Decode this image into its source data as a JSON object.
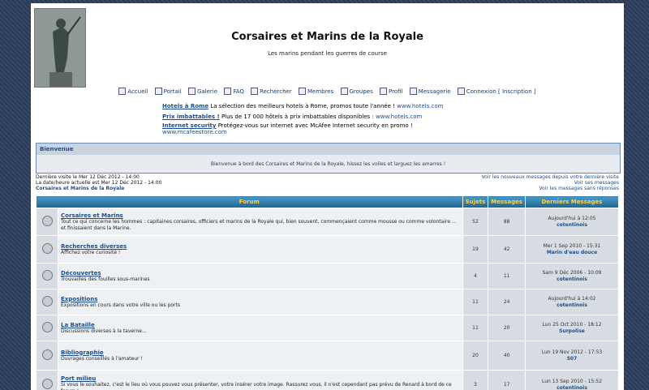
{
  "site": {
    "title": "Corsaires et Marins de la Royale",
    "description": "Les marins pendant les guerres de course"
  },
  "nav": [
    {
      "label": "Accueil",
      "icon": "home-icon"
    },
    {
      "label": "Portail",
      "icon": "portal-icon"
    },
    {
      "label": "Galerie",
      "icon": "gallery-icon"
    },
    {
      "label": "FAQ",
      "icon": "faq-icon"
    },
    {
      "label": "Rechercher",
      "icon": "search-icon"
    },
    {
      "label": "Membres",
      "icon": "members-icon"
    },
    {
      "label": "Groupes",
      "icon": "groups-icon"
    },
    {
      "label": "Profil",
      "icon": "profile-icon"
    },
    {
      "label": "Messagerie",
      "icon": "mail-icon"
    },
    {
      "label": "Connexion [ Inscription ]",
      "icon": "login-icon"
    }
  ],
  "ads": [
    {
      "title": "Hotels à Rome",
      "text": " La sélection des meilleurs hotels à Rome, promos toute l'année !",
      "url": "www.hotels.com"
    },
    {
      "title": "Prix imbattables !",
      "text": " Plus de 17 000 hôtels à prix imbattables disponibles :",
      "url": "www.hotels.com"
    },
    {
      "title": "Internet security",
      "text": " Protégez-vous sur internet avec McAfee Internet security en promo !",
      "url": "www.mcafeestore.com"
    }
  ],
  "welcome": {
    "title": "Bienvenue",
    "message": "Bienvenue à bord des Corsaires et Marins de la Royale, hissez les voiles et larguez les amarres !"
  },
  "info": {
    "last_visit": "Dernière visite le Mer 12 Déc 2012 - 14:00",
    "current_date": "La date/heure actuelle est Mer 12 Déc 2012 - 14:00",
    "breadcrumb": "Corsaires et Marins de la Royale",
    "new_messages": "Voir les nouveaux messages depuis votre dernière visite",
    "my_messages": "Voir ses messages",
    "unanswered": "Voir les messages sans réponses"
  },
  "table": {
    "headers": {
      "forum": "Forum",
      "topics": "Sujets",
      "posts": "Messages",
      "last": "Derniers Messages"
    },
    "rows": [
      {
        "name": "Corsaires et Marins",
        "desc": "Tout ce qui concerne les hommes : capitaines corsaires, officiers et marins de la Royale qui, bien souvent, commençaient comme mousse ou comme volontaire ... et finissaient dans la Marine.",
        "topics": "52",
        "posts": "88",
        "last_date": "Aujourd'hui à 12:05",
        "last_user": "cotentinois"
      },
      {
        "name": "Recherches diverses",
        "desc": "Affichez votre curiosité !",
        "topics": "19",
        "posts": "42",
        "last_date": "Mer 1 Sep 2010 - 15:31",
        "last_user": "Marin d'eau douce"
      },
      {
        "name": "Découvertes",
        "desc": "Trouvailles des fouilles sous-marines",
        "topics": "4",
        "posts": "11",
        "last_date": "Sam 9 Déc 2006 - 10:09",
        "last_user": "cotentinois"
      },
      {
        "name": "Expositions",
        "desc": "Expositions en cours dans votre ville ou les ports",
        "topics": "11",
        "posts": "24",
        "last_date": "Aujourd'hui à 14:02",
        "last_user": "cotentinois"
      },
      {
        "name": "La Bataille",
        "desc": "Discussions diverses à la taverne...",
        "topics": "11",
        "posts": "20",
        "last_date": "Lun 25 Oct 2010 - 18:12",
        "last_user": "Surpolise"
      },
      {
        "name": "Bibliographie",
        "desc": "Ouvrages conseillés à l'amateur !",
        "topics": "20",
        "posts": "40",
        "last_date": "Lun 19 Nov 2012 - 17:53",
        "last_user": "507"
      },
      {
        "name": "Port milieu",
        "desc": "Si vous le souhaitez, c'est le lieu où vous pouvez vous présenter, votre insérer votre image. Rassurez vous, il n'est cependant pas prévu de Renard à bord de ce forum !",
        "topics": "3",
        "posts": "17",
        "last_date": "Lun 13 Sep 2010 - 15:52",
        "last_user": "cotentinois"
      }
    ]
  }
}
